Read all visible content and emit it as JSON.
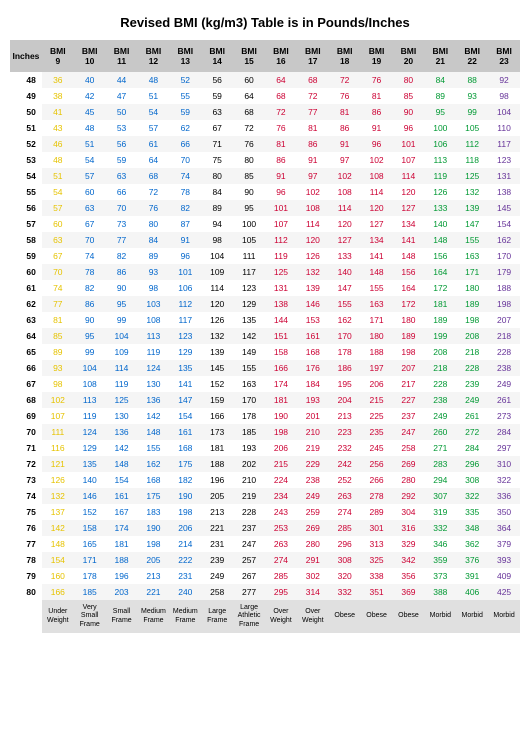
{
  "title": "Revised BMI (kg/m3) Table is in Pounds/Inches",
  "chart_data": {
    "type": "table",
    "row_header": "Inches",
    "columns": [
      "BMI 9",
      "BMI 10",
      "BMI 11",
      "BMI 12",
      "BMI 13",
      "BMI 14",
      "BMI 15",
      "BMI 16",
      "BMI 17",
      "BMI 18",
      "BMI 19",
      "BMI 20",
      "BMI 21",
      "BMI 22",
      "BMI 23"
    ],
    "categories": [
      "Under Weight",
      "Very Small Frame",
      "Small Frame",
      "Medium Frame",
      "Medium Frame",
      "Large Frame",
      "Large Athletic Frame",
      "Over Weight",
      "Over Weight",
      "Obese",
      "Obese",
      "Obese",
      "Morbid",
      "Morbid",
      "Morbid"
    ],
    "rows": [
      {
        "in": 48,
        "v": [
          36,
          40,
          44,
          48,
          52,
          56,
          60,
          64,
          68,
          72,
          76,
          80,
          84,
          88,
          92
        ]
      },
      {
        "in": 49,
        "v": [
          38,
          42,
          47,
          51,
          55,
          59,
          64,
          68,
          72,
          76,
          81,
          85,
          89,
          93,
          98
        ]
      },
      {
        "in": 50,
        "v": [
          41,
          45,
          50,
          54,
          59,
          63,
          68,
          72,
          77,
          81,
          86,
          90,
          95,
          99,
          104
        ]
      },
      {
        "in": 51,
        "v": [
          43,
          48,
          53,
          57,
          62,
          67,
          72,
          76,
          81,
          86,
          91,
          96,
          100,
          105,
          110
        ]
      },
      {
        "in": 52,
        "v": [
          46,
          51,
          56,
          61,
          66,
          71,
          76,
          81,
          86,
          91,
          96,
          101,
          106,
          112,
          117
        ]
      },
      {
        "in": 53,
        "v": [
          48,
          54,
          59,
          64,
          70,
          75,
          80,
          86,
          91,
          97,
          102,
          107,
          113,
          118,
          123
        ]
      },
      {
        "in": 54,
        "v": [
          51,
          57,
          63,
          68,
          74,
          80,
          85,
          91,
          97,
          102,
          108,
          114,
          119,
          125,
          131
        ]
      },
      {
        "in": 55,
        "v": [
          54,
          60,
          66,
          72,
          78,
          84,
          90,
          96,
          102,
          108,
          114,
          120,
          126,
          132,
          138
        ]
      },
      {
        "in": 56,
        "v": [
          57,
          63,
          70,
          76,
          82,
          89,
          95,
          101,
          108,
          114,
          120,
          127,
          133,
          139,
          145
        ]
      },
      {
        "in": 57,
        "v": [
          60,
          67,
          73,
          80,
          87,
          94,
          100,
          107,
          114,
          120,
          127,
          134,
          140,
          147,
          154
        ]
      },
      {
        "in": 58,
        "v": [
          63,
          70,
          77,
          84,
          91,
          98,
          105,
          112,
          120,
          127,
          134,
          141,
          148,
          155,
          162
        ]
      },
      {
        "in": 59,
        "v": [
          67,
          74,
          82,
          89,
          96,
          104,
          111,
          119,
          126,
          133,
          141,
          148,
          156,
          163,
          170
        ]
      },
      {
        "in": 60,
        "v": [
          70,
          78,
          86,
          93,
          101,
          109,
          117,
          125,
          132,
          140,
          148,
          156,
          164,
          171,
          179
        ]
      },
      {
        "in": 61,
        "v": [
          74,
          82,
          90,
          98,
          106,
          114,
          123,
          131,
          139,
          147,
          155,
          164,
          172,
          180,
          188
        ]
      },
      {
        "in": 62,
        "v": [
          77,
          86,
          95,
          103,
          112,
          120,
          129,
          138,
          146,
          155,
          163,
          172,
          181,
          189,
          198
        ]
      },
      {
        "in": 63,
        "v": [
          81,
          90,
          99,
          108,
          117,
          126,
          135,
          144,
          153,
          162,
          171,
          180,
          189,
          198,
          207
        ]
      },
      {
        "in": 64,
        "v": [
          85,
          95,
          104,
          113,
          123,
          132,
          142,
          151,
          161,
          170,
          180,
          189,
          199,
          208,
          218
        ]
      },
      {
        "in": 65,
        "v": [
          89,
          99,
          109,
          119,
          129,
          139,
          149,
          158,
          168,
          178,
          188,
          198,
          208,
          218,
          228
        ]
      },
      {
        "in": 66,
        "v": [
          93,
          104,
          114,
          124,
          135,
          145,
          155,
          166,
          176,
          186,
          197,
          207,
          218,
          228,
          238
        ]
      },
      {
        "in": 67,
        "v": [
          98,
          108,
          119,
          130,
          141,
          152,
          163,
          174,
          184,
          195,
          206,
          217,
          228,
          239,
          249
        ]
      },
      {
        "in": 68,
        "v": [
          102,
          113,
          125,
          136,
          147,
          159,
          170,
          181,
          193,
          204,
          215,
          227,
          238,
          249,
          261
        ]
      },
      {
        "in": 69,
        "v": [
          107,
          119,
          130,
          142,
          154,
          166,
          178,
          190,
          201,
          213,
          225,
          237,
          249,
          261,
          273
        ]
      },
      {
        "in": 70,
        "v": [
          111,
          124,
          136,
          148,
          161,
          173,
          185,
          198,
          210,
          223,
          235,
          247,
          260,
          272,
          284
        ]
      },
      {
        "in": 71,
        "v": [
          116,
          129,
          142,
          155,
          168,
          181,
          193,
          206,
          219,
          232,
          245,
          258,
          271,
          284,
          297
        ]
      },
      {
        "in": 72,
        "v": [
          121,
          135,
          148,
          162,
          175,
          188,
          202,
          215,
          229,
          242,
          256,
          269,
          283,
          296,
          310
        ]
      },
      {
        "in": 73,
        "v": [
          126,
          140,
          154,
          168,
          182,
          196,
          210,
          224,
          238,
          252,
          266,
          280,
          294,
          308,
          322
        ]
      },
      {
        "in": 74,
        "v": [
          132,
          146,
          161,
          175,
          190,
          205,
          219,
          234,
          249,
          263,
          278,
          292,
          307,
          322,
          336
        ]
      },
      {
        "in": 75,
        "v": [
          137,
          152,
          167,
          183,
          198,
          213,
          228,
          243,
          259,
          274,
          289,
          304,
          319,
          335,
          350
        ]
      },
      {
        "in": 76,
        "v": [
          142,
          158,
          174,
          190,
          206,
          221,
          237,
          253,
          269,
          285,
          301,
          316,
          332,
          348,
          364
        ]
      },
      {
        "in": 77,
        "v": [
          148,
          165,
          181,
          198,
          214,
          231,
          247,
          263,
          280,
          296,
          313,
          329,
          346,
          362,
          379
        ]
      },
      {
        "in": 78,
        "v": [
          154,
          171,
          188,
          205,
          222,
          239,
          257,
          274,
          291,
          308,
          325,
          342,
          359,
          376,
          393
        ]
      },
      {
        "in": 79,
        "v": [
          160,
          178,
          196,
          213,
          231,
          249,
          267,
          285,
          302,
          320,
          338,
          356,
          373,
          391,
          409
        ]
      },
      {
        "in": 80,
        "v": [
          166,
          185,
          203,
          221,
          240,
          258,
          277,
          295,
          314,
          332,
          351,
          369,
          388,
          406,
          425
        ]
      }
    ],
    "column_colors": [
      "yellow",
      "blue",
      "blue",
      "blue",
      "blue",
      "black",
      "black",
      "red",
      "red",
      "red",
      "red",
      "red",
      "green",
      "green",
      "purple"
    ]
  }
}
